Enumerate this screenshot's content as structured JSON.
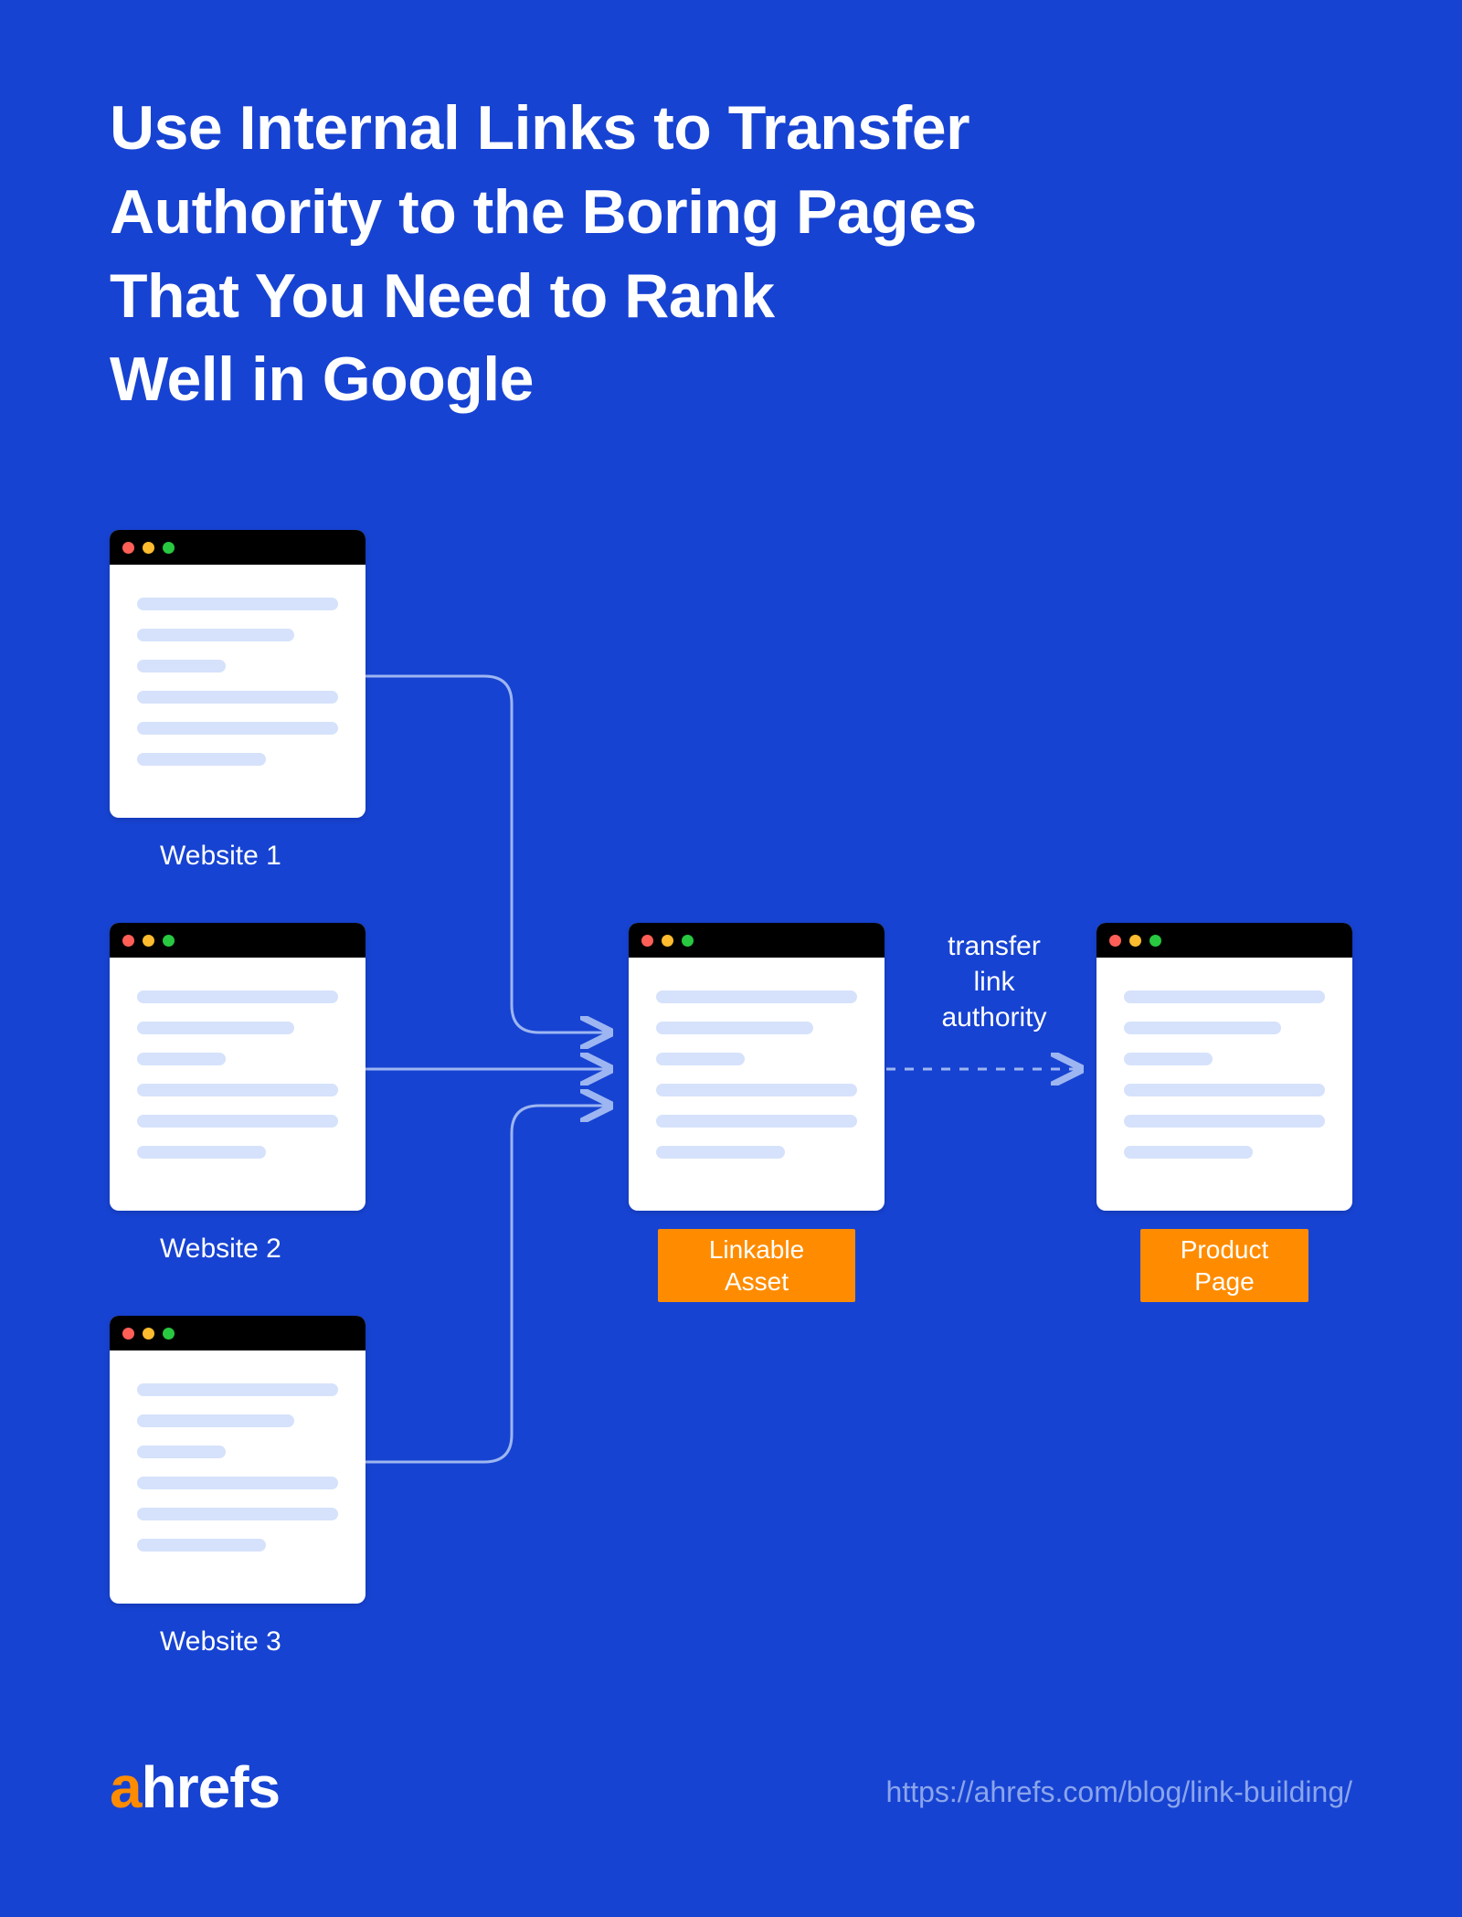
{
  "title": "Use Internal Links to Transfer\nAuthority to the Boring Pages\nThat You Need to Rank\nWell in Google",
  "websites": [
    {
      "label": "Website 1"
    },
    {
      "label": "Website 2"
    },
    {
      "label": "Website 3"
    }
  ],
  "linkable_asset_tag": "Linkable\nAsset",
  "product_page_tag": "Product\nPage",
  "edge_label": "transfer\nlink\nauthority",
  "logo_a": "a",
  "logo_rest": "hrefs",
  "footer_url": "https://ahrefs.com/blog/link-building/"
}
